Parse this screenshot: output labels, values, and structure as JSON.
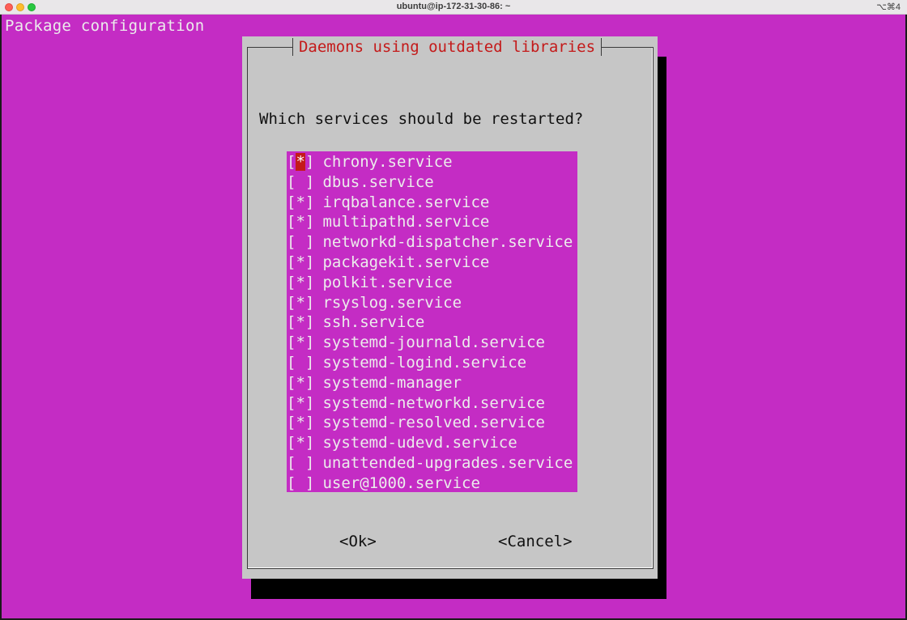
{
  "window": {
    "title": "ubuntu@ip-172-31-30-86: ~",
    "shortcut": "⌥⌘4"
  },
  "terminal": {
    "header": "Package configuration"
  },
  "dialog": {
    "title": "Daemons using outdated libraries",
    "question": "Which services should be restarted?",
    "services": [
      {
        "checked": true,
        "name": "chrony.service"
      },
      {
        "checked": false,
        "name": "dbus.service"
      },
      {
        "checked": true,
        "name": "irqbalance.service"
      },
      {
        "checked": true,
        "name": "multipathd.service"
      },
      {
        "checked": false,
        "name": "networkd-dispatcher.service"
      },
      {
        "checked": true,
        "name": "packagekit.service"
      },
      {
        "checked": true,
        "name": "polkit.service"
      },
      {
        "checked": true,
        "name": "rsyslog.service"
      },
      {
        "checked": true,
        "name": "ssh.service"
      },
      {
        "checked": true,
        "name": "systemd-journald.service"
      },
      {
        "checked": false,
        "name": "systemd-logind.service"
      },
      {
        "checked": true,
        "name": "systemd-manager"
      },
      {
        "checked": true,
        "name": "systemd-networkd.service"
      },
      {
        "checked": true,
        "name": "systemd-resolved.service"
      },
      {
        "checked": true,
        "name": "systemd-udevd.service"
      },
      {
        "checked": false,
        "name": "unattended-upgrades.service"
      },
      {
        "checked": false,
        "name": "user@1000.service"
      }
    ],
    "ok_label": "<Ok>",
    "cancel_label": "<Cancel>"
  },
  "colors": {
    "terminal_bg": "#c42cc4",
    "dialog_bg": "#c6c6c6",
    "title_red": "#c41a1a",
    "cursor_red": "#c41a1a"
  }
}
